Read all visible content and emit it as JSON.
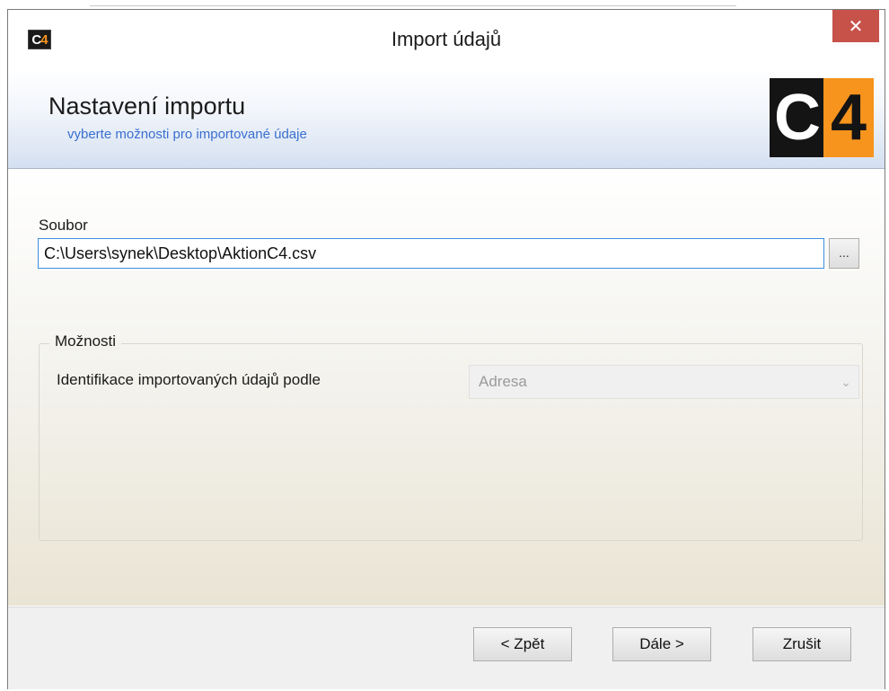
{
  "window": {
    "title": "Import údajů",
    "close_label": "✕"
  },
  "header": {
    "title": "Nastavení importu",
    "subtitle": "vyberte možnosti pro importované údaje",
    "logo_left": "C",
    "logo_right": "4"
  },
  "app_icon": {
    "left": "C",
    "right": "4"
  },
  "file": {
    "label": "Soubor",
    "value": "C:\\Users\\synek\\Desktop\\AktionC4.csv",
    "browse_label": "..."
  },
  "options": {
    "legend": "Možnosti",
    "identify_label": "Identifikace importovaných údajů podle",
    "identify_value": "Adresa"
  },
  "buttons": {
    "back": "< Zpět",
    "next": "Dále >",
    "cancel": "Zrušit"
  },
  "colors": {
    "logo_orange": "#f7941d",
    "close_red": "#c7524a",
    "subtitle_blue": "#3a6fd0"
  }
}
